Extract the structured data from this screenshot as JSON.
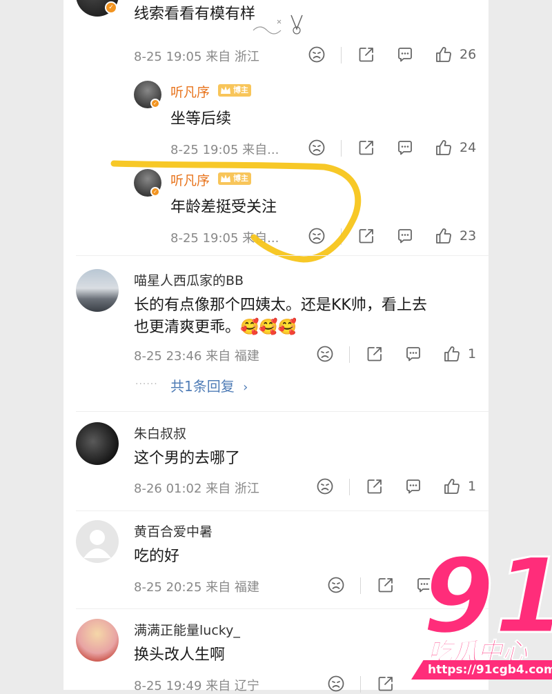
{
  "icons": {
    "dislike": "dislike-face-icon",
    "share": "share-icon",
    "comment": "comment-icon",
    "like": "thumbs-up-icon",
    "verified": "verified-badge-icon",
    "chevron": "chevron-right-icon"
  },
  "colors": {
    "accent_orange": "#e8731b",
    "link_blue": "#4f7cb6",
    "annotation_yellow": "#f7c51b",
    "watermark_pink": "#ff2d7a"
  },
  "comments": [
    {
      "text": "线索看看有模有样",
      "meta": "8-25 19:05 来自 浙江",
      "likes": "26"
    },
    {
      "username": "听凡序",
      "badge": "博主",
      "text": "坐等后续",
      "meta": "8-25 19:05 来自...",
      "likes": "24"
    },
    {
      "username": "听凡序",
      "badge": "博主",
      "text": "年龄差挺受关注",
      "meta": "8-25 19:05 来自...",
      "likes": "23"
    },
    {
      "username": "喵星人西瓜家的BB",
      "text_line1": "长的有点像那个四姨太。还是KK帅，看上去",
      "text_line2": "也更清爽更乖。🥰🥰🥰",
      "meta": "8-25 23:46 来自 福建",
      "likes": "1",
      "replies_link": "共1条回复",
      "replies_dots": "······"
    },
    {
      "username": "朱白叔叔",
      "text": "这个男的去哪了",
      "meta": "8-26 01:02 来自 浙江",
      "likes": "1"
    },
    {
      "username": "黄百合爱中暑",
      "text": "吃的好",
      "meta": "8-25 20:25 来自 福建",
      "likes": ""
    },
    {
      "username": "满满正能量lucky_",
      "text": "换头改人生啊",
      "meta": "8-25 19:49 来自 辽宁",
      "likes": ""
    }
  ],
  "watermark": {
    "number": "91",
    "title": "吃瓜中心",
    "url": "https://91cgb4.com"
  }
}
